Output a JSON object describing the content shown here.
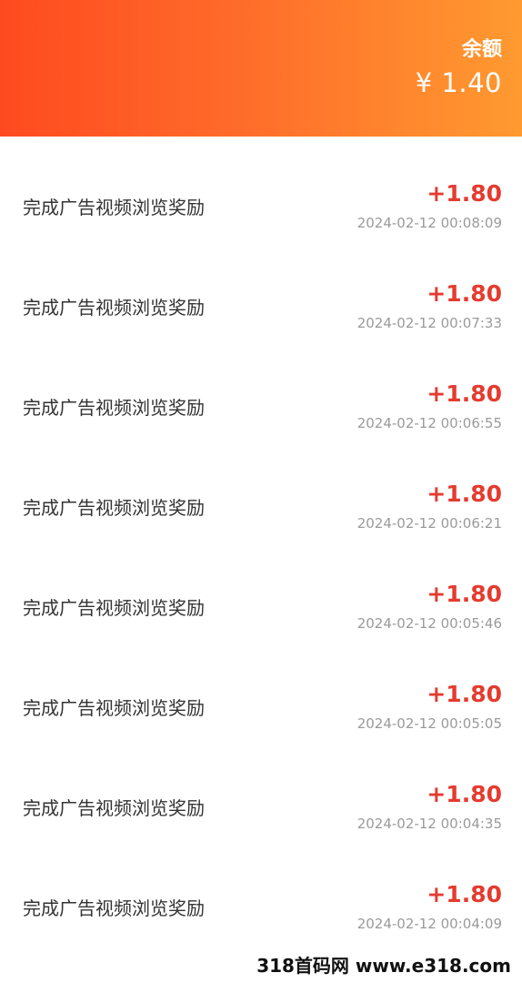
{
  "header": {
    "balance_label": "余额",
    "balance_value": "¥ 1.40",
    "gradient_colors": [
      "#ff4a1f",
      "#ff9a30"
    ]
  },
  "records": [
    {
      "title": "完成广告视频浏览奖励",
      "amount": "+1.80",
      "time": "2024-02-12 00:08:09"
    },
    {
      "title": "完成广告视频浏览奖励",
      "amount": "+1.80",
      "time": "2024-02-12 00:07:33"
    },
    {
      "title": "完成广告视频浏览奖励",
      "amount": "+1.80",
      "time": "2024-02-12 00:06:55"
    },
    {
      "title": "完成广告视频浏览奖励",
      "amount": "+1.80",
      "time": "2024-02-12 00:06:21"
    },
    {
      "title": "完成广告视频浏览奖励",
      "amount": "+1.80",
      "time": "2024-02-12 00:05:46"
    },
    {
      "title": "完成广告视频浏览奖励",
      "amount": "+1.80",
      "time": "2024-02-12 00:05:05"
    },
    {
      "title": "完成广告视频浏览奖励",
      "amount": "+1.80",
      "time": "2024-02-12 00:04:35"
    },
    {
      "title": "完成广告视频浏览奖励",
      "amount": "+1.80",
      "time": "2024-02-12 00:04:09"
    }
  ],
  "watermark": "318首码网 www.e318.com",
  "colors": {
    "amount": "#e53b2f",
    "timestamp": "#9a9a9a"
  }
}
